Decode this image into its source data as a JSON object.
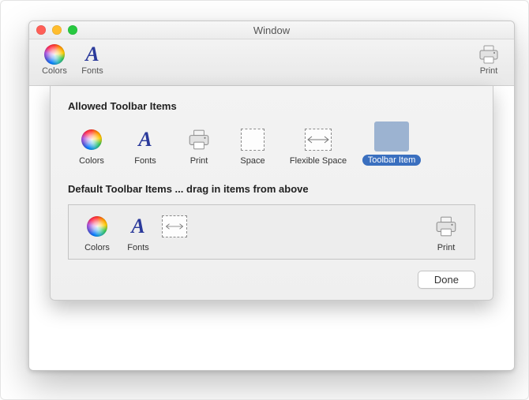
{
  "window": {
    "title": "Window"
  },
  "toolbar": {
    "colors": "Colors",
    "fonts": "Fonts",
    "print": "Print"
  },
  "sheet": {
    "allowed_heading": "Allowed Toolbar Items",
    "default_heading": "Default Toolbar Items ... drag in items from above",
    "done_label": "Done",
    "items": {
      "colors": "Colors",
      "fonts": "Fonts",
      "print": "Print",
      "space": "Space",
      "flexible_space": "Flexible Space",
      "toolbar_item": "Toolbar Item"
    }
  }
}
